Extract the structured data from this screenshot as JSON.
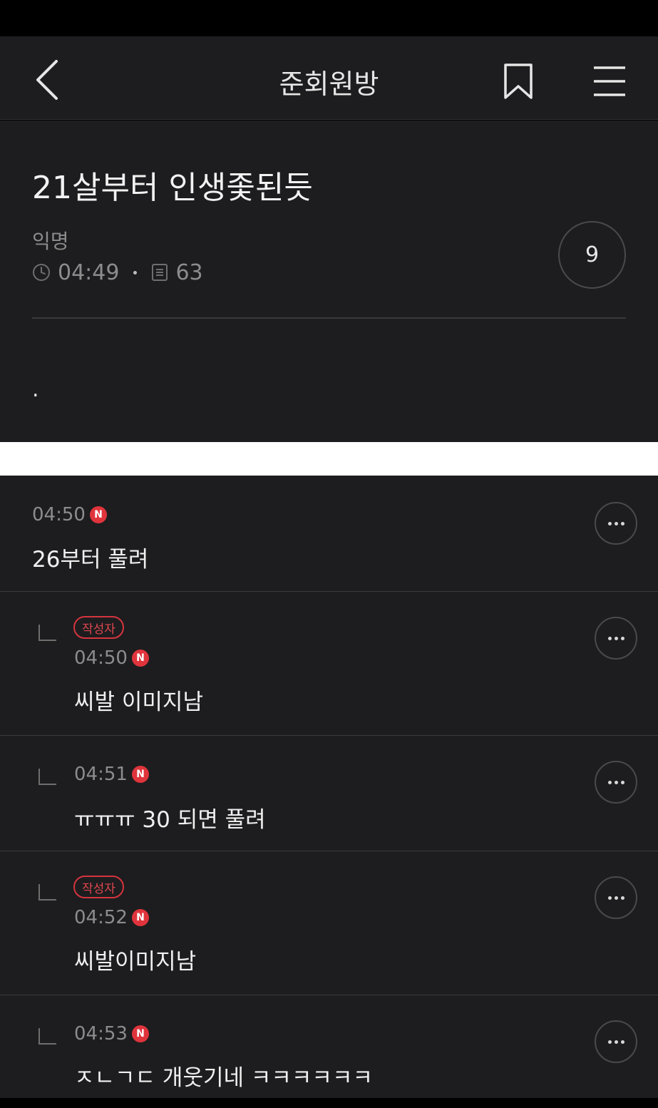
{
  "header": {
    "title": "준회원방",
    "back_icon": "chevron-left-icon",
    "bookmark_icon": "bookmark-icon",
    "menu_icon": "hamburger-menu-icon"
  },
  "post": {
    "title": "21살부터 인생좇된듯",
    "author": "익명",
    "time": "04:49",
    "views": "63",
    "comment_count": "9",
    "body": "."
  },
  "comments": [
    {
      "is_reply": false,
      "is_author": false,
      "time": "04:50",
      "new_badge": "N",
      "text": "26부터 풀려"
    },
    {
      "is_reply": true,
      "is_author": true,
      "author_tag": "작성자",
      "time": "04:50",
      "new_badge": "N",
      "text": "씨발 이미지남"
    },
    {
      "is_reply": true,
      "is_author": false,
      "time": "04:51",
      "new_badge": "N",
      "text": "ㅠㅠㅠ 30 되면 풀려"
    },
    {
      "is_reply": true,
      "is_author": true,
      "author_tag": "작성자",
      "time": "04:52",
      "new_badge": "N",
      "text": "씨발이미지남"
    },
    {
      "is_reply": true,
      "is_author": false,
      "time": "04:53",
      "new_badge": "N",
      "text": "ㅈㄴㄱㄷ 개웃기네 ㅋㅋㅋㅋㅋㅋ"
    }
  ],
  "colors": {
    "background": "#1d1d1f",
    "accent_red": "#e0343c",
    "muted_text": "#8c8c8c"
  }
}
